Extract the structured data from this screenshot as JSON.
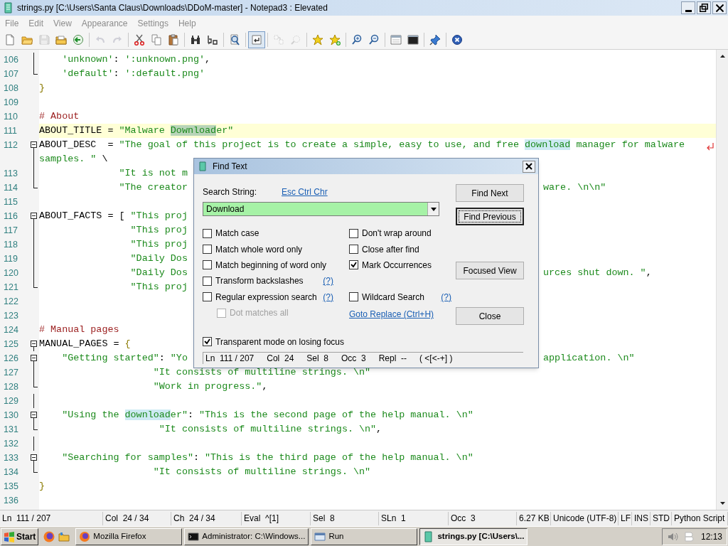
{
  "window": {
    "title": "strings.py [C:\\Users\\Santa Claus\\Downloads\\DDoM-master] - Notepad3 : Elevated"
  },
  "menu": [
    "File",
    "Edit",
    "View",
    "Appearance",
    "Settings",
    "Help"
  ],
  "toolbar": [
    {
      "kind": "new",
      "disabled": false,
      "pressed": false
    },
    {
      "kind": "open",
      "disabled": false,
      "pressed": false
    },
    {
      "kind": "save",
      "disabled": true,
      "pressed": false
    },
    {
      "kind": "favorites",
      "disabled": false,
      "pressed": false
    },
    {
      "kind": "browse",
      "disabled": false,
      "pressed": false
    },
    {
      "kind": "separator"
    },
    {
      "kind": "undo",
      "disabled": true,
      "pressed": false
    },
    {
      "kind": "redo",
      "disabled": true,
      "pressed": false
    },
    {
      "kind": "separator"
    },
    {
      "kind": "cut",
      "disabled": false,
      "pressed": false
    },
    {
      "kind": "copy",
      "disabled": false,
      "pressed": false
    },
    {
      "kind": "paste",
      "disabled": false,
      "pressed": false
    },
    {
      "kind": "separator"
    },
    {
      "kind": "find",
      "disabled": false,
      "pressed": false
    },
    {
      "kind": "replace",
      "disabled": false,
      "pressed": false
    },
    {
      "kind": "separator"
    },
    {
      "kind": "zoom-find",
      "disabled": false,
      "pressed": false
    },
    {
      "kind": "separator"
    },
    {
      "kind": "wordwrap",
      "disabled": false,
      "pressed": true
    },
    {
      "kind": "separator"
    },
    {
      "kind": "columns",
      "disabled": true,
      "pressed": false
    },
    {
      "kind": "lookup",
      "disabled": true,
      "pressed": false
    },
    {
      "kind": "separator"
    },
    {
      "kind": "star",
      "disabled": false,
      "pressed": false
    },
    {
      "kind": "star-add",
      "disabled": false,
      "pressed": false
    },
    {
      "kind": "separator"
    },
    {
      "kind": "zoom-in",
      "disabled": false,
      "pressed": false
    },
    {
      "kind": "zoom-out",
      "disabled": false,
      "pressed": false
    },
    {
      "kind": "separator"
    },
    {
      "kind": "window",
      "disabled": false,
      "pressed": false
    },
    {
      "kind": "terminal",
      "disabled": false,
      "pressed": false
    },
    {
      "kind": "separator"
    },
    {
      "kind": "pin",
      "disabled": false,
      "pressed": false
    },
    {
      "kind": "separator"
    },
    {
      "kind": "exit",
      "disabled": false,
      "pressed": false
    }
  ],
  "editor": {
    "lines": [
      {
        "number": "106",
        "fold": {
          "kind": "inside"
        },
        "tokens": [
          {
            "text": "    'unknown'",
            "kind": "string"
          },
          {
            "text": ": ",
            "kind": "plain"
          },
          {
            "text": "':unknown.png'",
            "kind": "string"
          },
          {
            "text": ",",
            "kind": "plain"
          }
        ]
      },
      {
        "number": "107",
        "fold": {
          "kind": "end"
        },
        "tokens": [
          {
            "text": "    'default'",
            "kind": "string"
          },
          {
            "text": ": ",
            "kind": "plain"
          },
          {
            "text": "':default.png'",
            "kind": "string"
          }
        ]
      },
      {
        "number": "108",
        "tokens": [
          {
            "text": "}",
            "kind": "brace"
          }
        ]
      },
      {
        "number": "109"
      },
      {
        "number": "110",
        "tokens": [
          {
            "text": "# About",
            "kind": "comment"
          }
        ]
      },
      {
        "number": "111",
        "current": true,
        "tokens": [
          {
            "text": "ABOUT_TITLE = ",
            "kind": "plain"
          },
          {
            "text": "\"Malware ",
            "kind": "string"
          },
          {
            "text": "Download",
            "kind": "selection"
          },
          {
            "text": "er\"",
            "kind": "string"
          }
        ]
      },
      {
        "number": "112",
        "fold": {
          "kind": "start"
        },
        "wrapped": true,
        "tokens": [
          {
            "text": "ABOUT_DESC  = ",
            "kind": "plain"
          },
          {
            "text": "\"The goal of this project is to create a simple, easy to use, and free ",
            "kind": "string"
          },
          {
            "text": "download",
            "kind": "occurrence"
          },
          {
            "text": " manager for malware",
            "kind": "string"
          }
        ]
      },
      {
        "fold": {
          "kind": "inside"
        },
        "tokens": [
          {
            "text": "samples. \"",
            "kind": "string"
          },
          {
            "text": " \\",
            "kind": "plain"
          }
        ]
      },
      {
        "number": "113",
        "fold": {
          "kind": "inside"
        },
        "tokens": [
          {
            "text": "              \"It is not m",
            "kind": "string"
          }
        ]
      },
      {
        "number": "114",
        "fold": {
          "kind": "end"
        },
        "tokens": [
          {
            "text": "              \"The creator",
            "kind": "string"
          }
        ],
        "right_tokens": [
          {
            "text": "ware. \\n\\n\"",
            "kind": "string"
          }
        ]
      },
      {
        "number": "115"
      },
      {
        "number": "116",
        "fold": {
          "kind": "start"
        },
        "tokens": [
          {
            "text": "ABOUT_FACTS = [ ",
            "kind": "plain"
          },
          {
            "text": "\"This proj",
            "kind": "string"
          }
        ]
      },
      {
        "number": "117",
        "fold": {
          "kind": "inside"
        },
        "tokens": [
          {
            "text": "                \"This proj",
            "kind": "string"
          }
        ]
      },
      {
        "number": "118",
        "fold": {
          "kind": "inside"
        },
        "tokens": [
          {
            "text": "                \"This proj",
            "kind": "string"
          }
        ]
      },
      {
        "number": "119",
        "fold": {
          "kind": "inside"
        },
        "tokens": [
          {
            "text": "                \"Daily Dos",
            "kind": "string"
          }
        ]
      },
      {
        "number": "120",
        "fold": {
          "kind": "inside"
        },
        "tokens": [
          {
            "text": "                \"Daily Dos",
            "kind": "string"
          }
        ],
        "right_tokens": [
          {
            "text": "urces shut down. \"",
            "kind": "string"
          },
          {
            "text": ",",
            "kind": "plain"
          }
        ]
      },
      {
        "number": "121",
        "fold": {
          "kind": "end"
        },
        "tokens": [
          {
            "text": "                \"This proj",
            "kind": "string"
          }
        ]
      },
      {
        "number": "122"
      },
      {
        "number": "123"
      },
      {
        "number": "124",
        "tokens": [
          {
            "text": "# Manual pages",
            "kind": "comment"
          }
        ]
      },
      {
        "number": "125",
        "fold": {
          "kind": "start"
        },
        "tokens": [
          {
            "text": "MANUAL_PAGES = ",
            "kind": "plain"
          },
          {
            "text": "{",
            "kind": "brace"
          }
        ]
      },
      {
        "number": "126",
        "fold": {
          "kind": "start"
        },
        "tokens": [
          {
            "text": "    \"Getting started\"",
            "kind": "string"
          },
          {
            "text": ": ",
            "kind": "plain"
          },
          {
            "text": "\"Yo",
            "kind": "string"
          }
        ],
        "right_tokens": [
          {
            "text": "application. \\n\"",
            "kind": "string"
          }
        ]
      },
      {
        "number": "127",
        "fold": {
          "kind": "inside"
        },
        "tokens": [
          {
            "text": "                    \"It consists of multiline strings. \\n\"",
            "kind": "string"
          }
        ]
      },
      {
        "number": "128",
        "fold": {
          "kind": "end"
        },
        "tokens": [
          {
            "text": "                    \"Work in progress.\"",
            "kind": "string"
          },
          {
            "text": ",",
            "kind": "plain"
          }
        ]
      },
      {
        "number": "129",
        "fold": {
          "kind": "inside"
        }
      },
      {
        "number": "130",
        "fold": {
          "kind": "start"
        },
        "tokens": [
          {
            "text": "    \"Using the ",
            "kind": "string"
          },
          {
            "text": "download",
            "kind": "occurrence"
          },
          {
            "text": "er\"",
            "kind": "string"
          },
          {
            "text": ": ",
            "kind": "plain"
          },
          {
            "text": "\"This is the second page of the help manual. \\n\"",
            "kind": "string"
          }
        ]
      },
      {
        "number": "131",
        "fold": {
          "kind": "end"
        },
        "tokens": [
          {
            "text": "                     \"It consists of multiline strings. \\n\"",
            "kind": "string"
          },
          {
            "text": ",",
            "kind": "plain"
          }
        ]
      },
      {
        "number": "132",
        "fold": {
          "kind": "inside"
        }
      },
      {
        "number": "133",
        "fold": {
          "kind": "start"
        },
        "tokens": [
          {
            "text": "    \"Searching for samples\"",
            "kind": "string"
          },
          {
            "text": ": ",
            "kind": "plain"
          },
          {
            "text": "\"This is the third page of the help manual. \\n\"",
            "kind": "string"
          }
        ]
      },
      {
        "number": "134",
        "fold": {
          "kind": "end"
        },
        "tokens": [
          {
            "text": "                    \"It consists of multiline strings. \\n\"",
            "kind": "string"
          }
        ]
      },
      {
        "number": "135",
        "tokens": [
          {
            "text": "}",
            "kind": "brace"
          }
        ]
      },
      {
        "number": "136"
      }
    ]
  },
  "find_dialog": {
    "title": "Find Text",
    "search_label": "Search String:",
    "esc_link": "Esc Ctrl Chr",
    "search_value": "Download",
    "left_options": [
      {
        "label": "Match case",
        "checked": false,
        "disabled": false
      },
      {
        "label": "Match whole word only",
        "checked": false,
        "disabled": false
      },
      {
        "label": "Match beginning of word only",
        "checked": false,
        "disabled": false
      },
      {
        "label": "Transform backslashes",
        "checked": false,
        "disabled": false,
        "help": "(?)"
      },
      {
        "label": "Regular expression search",
        "checked": false,
        "disabled": false,
        "help": "(?)"
      },
      {
        "label": "Dot matches all",
        "checked": false,
        "disabled": true
      }
    ],
    "right_options": [
      {
        "label": "Don't wrap around",
        "checked": false,
        "disabled": false
      },
      {
        "label": "Close after find",
        "checked": false,
        "disabled": false
      },
      {
        "label": "Mark Occurrences",
        "checked": true,
        "disabled": false
      },
      {
        "label": "Wildcard Search",
        "checked": false,
        "disabled": false,
        "help": "(?)"
      }
    ],
    "replace_link": "Goto Replace (Ctrl+H)",
    "transparent": {
      "label": "Transparent mode on losing focus",
      "checked": true
    },
    "buttons": [
      {
        "label": "Find Next",
        "default": false
      },
      {
        "label": "Find Previous",
        "default": true
      },
      {
        "label": "Focused View",
        "default": false
      },
      {
        "label": "Close",
        "default": false
      }
    ],
    "status": [
      "Ln  111 / 207",
      "Col  24",
      "Sel  8",
      "Occ  3",
      "Repl  --",
      "( <[<-+] )"
    ]
  },
  "status_bar": [
    "Ln  111 / 207",
    "Col  24 / 34",
    "Ch  24 / 34",
    "Eval  ^[1]",
    "Sel  8",
    "SLn  1",
    "Occ  3",
    "6.27 KB",
    "Unicode (UTF-8)",
    "LF",
    "INS",
    "STD",
    "Python Script"
  ],
  "taskbar": {
    "start": "Start",
    "tasks": [
      {
        "label": "Mozilla Firefox",
        "kind": "browser",
        "selected": false
      },
      {
        "label": "Administrator: C:\\Windows...",
        "kind": "console",
        "selected": false
      },
      {
        "label": "Run",
        "kind": "run",
        "selected": false
      },
      {
        "label": "strings.py [C:\\Users\\...",
        "kind": "editor",
        "selected": true
      }
    ],
    "clock": "12:13"
  }
}
